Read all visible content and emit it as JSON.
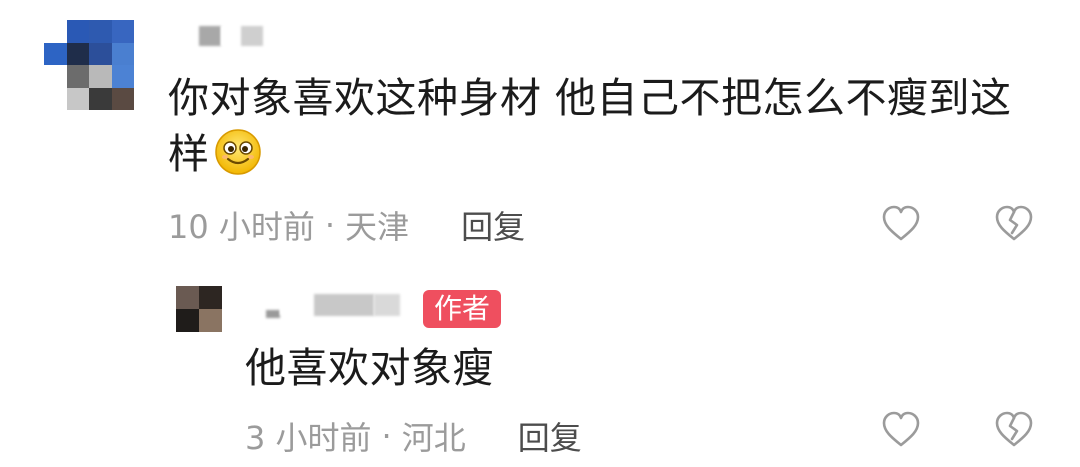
{
  "comments": [
    {
      "text": "你对象喜欢这种身材 他自己不把怎么不瘦到这样",
      "emoji": "smiling-face-emoji",
      "time": "10 小时前",
      "separator": "·",
      "location": "天津",
      "reply_label": "回复",
      "actions": [
        "heart-icon",
        "broken-heart-icon"
      ]
    },
    {
      "badge": "作者",
      "text": "他喜欢对象瘦",
      "time": "3 小时前",
      "separator": "·",
      "location": "河北",
      "reply_label": "回复",
      "actions": [
        "heart-icon",
        "broken-heart-icon"
      ]
    }
  ],
  "colors": {
    "badge_bg": "#ef4f5f",
    "meta_text": "#9b9b9b",
    "reply_text": "#4d4d4d",
    "icon_stroke": "#9b9b9b"
  }
}
